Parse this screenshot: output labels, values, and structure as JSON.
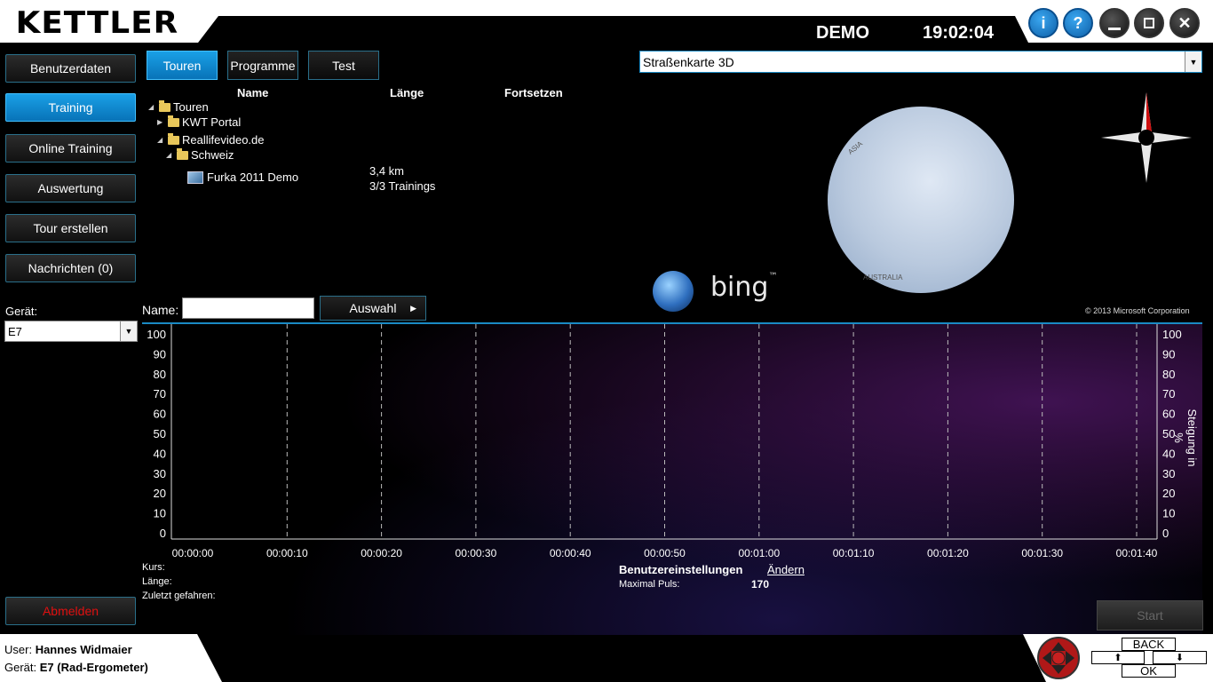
{
  "header": {
    "logo": "KETTLER",
    "mode": "DEMO",
    "time": "19:02:04",
    "buttons": [
      {
        "id": "info",
        "label": "i",
        "icon": "info-icon"
      },
      {
        "id": "help",
        "label": "?",
        "icon": "help-icon"
      },
      {
        "id": "minimize",
        "label": "",
        "icon": "minimize-icon"
      },
      {
        "id": "maximize",
        "label": "",
        "icon": "restore-icon"
      },
      {
        "id": "close",
        "label": "✕",
        "icon": "close-icon"
      }
    ]
  },
  "sidebar": {
    "items": [
      {
        "label": "Benutzerdaten",
        "active": false
      },
      {
        "label": "Training",
        "active": true
      },
      {
        "label": "Online Training",
        "active": false
      },
      {
        "label": "Auswertung",
        "active": false
      },
      {
        "label": "Tour erstellen",
        "active": false
      },
      {
        "label": "Nachrichten (0)",
        "active": false
      }
    ],
    "device_label": "Gerät:",
    "device_value": "E7",
    "logout_label": "Abmelden"
  },
  "tabs": [
    {
      "label": "Touren",
      "active": true
    },
    {
      "label": "Programme",
      "active": false
    },
    {
      "label": "Test",
      "active": false
    }
  ],
  "map_select": {
    "value": "Straßenkarte 3D"
  },
  "tree": {
    "columns": [
      "Name",
      "Länge",
      "Fortsetzen"
    ],
    "nodes": [
      {
        "label": "Touren",
        "level": 0,
        "expanded": true
      },
      {
        "label": "KWT Portal",
        "level": 1,
        "expanded": false
      },
      {
        "label": "Reallifevideo.de",
        "level": 1,
        "expanded": true
      },
      {
        "label": "Schweiz",
        "level": 2,
        "expanded": true
      }
    ],
    "tour": {
      "name": "Furka 2011 Demo",
      "length": "3,4 km",
      "trainings": "3/3  Trainings"
    }
  },
  "map": {
    "bing_label": "bing",
    "bing_tm": "™",
    "copyright": "© 2013 Microsoft Corporation",
    "globe_labels": {
      "asia": "ASIA",
      "australia": "AUSTRALIA"
    }
  },
  "name_filter": {
    "label": "Name:",
    "value": "",
    "select_label": "Auswahl"
  },
  "chart_data": {
    "type": "line",
    "title": "",
    "xlabel": "",
    "ylabel_right": "Steigung in %",
    "y_ticks_left": [
      100,
      90,
      80,
      70,
      60,
      50,
      40,
      30,
      20,
      10,
      0
    ],
    "y_ticks_right": [
      100,
      90,
      80,
      70,
      60,
      50,
      40,
      30,
      20,
      10,
      0
    ],
    "x_ticks": [
      "00:00:00",
      "00:00:10",
      "00:00:20",
      "00:00:30",
      "00:00:40",
      "00:00:50",
      "00:01:00",
      "00:01:10",
      "00:01:20",
      "00:01:30",
      "00:01:40"
    ],
    "ylim": [
      0,
      100
    ],
    "series": [],
    "grid": "vertical dashed"
  },
  "info": {
    "kurs_label": "Kurs:",
    "laenge_label": "Länge:",
    "zuletzt_label": "Zuletzt gefahren:",
    "settings_title": "Benutzereinstellungen",
    "change_link": "Ändern",
    "max_pulse_label": "Maximal Puls:",
    "max_pulse_value": "170"
  },
  "start_label": "Start",
  "footer": {
    "user_label": "User:",
    "user_value": "Hannes Widmaier",
    "device_label": "Gerät:",
    "device_value": "E7 (Rad-Ergometer)",
    "back_label": "BACK",
    "ok_label": "OK",
    "up_label": "⬆",
    "down_label": "⬇"
  }
}
